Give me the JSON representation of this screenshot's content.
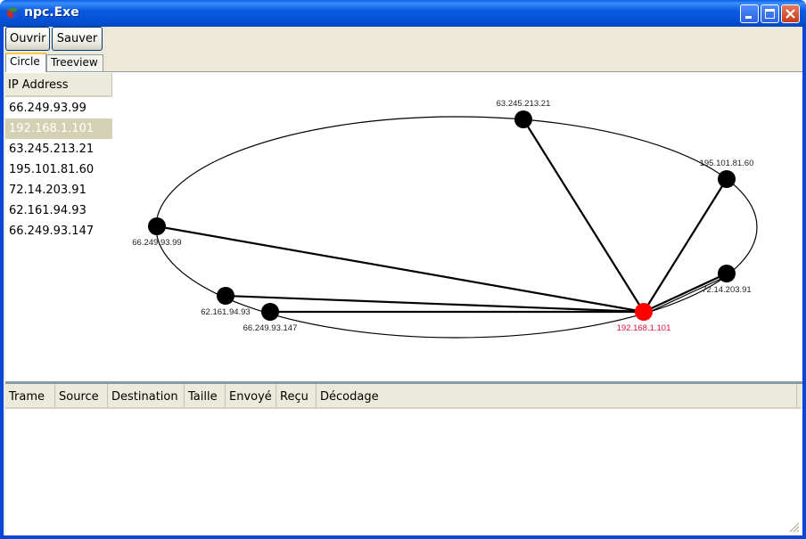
{
  "window": {
    "title": "npc.Exe",
    "controls": {
      "minimize": "minimize",
      "maximize": "maximize",
      "close": "close"
    }
  },
  "toolbar": {
    "open_label": "Ouvrir",
    "save_label": "Sauver"
  },
  "tabs": [
    {
      "label": "Circle",
      "active": true
    },
    {
      "label": "Treeview",
      "active": false
    }
  ],
  "ip_list": {
    "header": "IP Address",
    "items": [
      {
        "ip": "66.249.93.99",
        "selected": false
      },
      {
        "ip": "192.168.1.101",
        "selected": true
      },
      {
        "ip": "63.245.213.21",
        "selected": false
      },
      {
        "ip": "195.101.81.60",
        "selected": false
      },
      {
        "ip": "72.14.203.91",
        "selected": false
      },
      {
        "ip": "62.161.94.93",
        "selected": false
      },
      {
        "ip": "66.249.93.147",
        "selected": false
      }
    ]
  },
  "graph": {
    "layout": "circle",
    "center_node": "192.168.1.101",
    "colors": {
      "node": "#000000",
      "center_node": "#ff0000",
      "center_label": "#e0103a",
      "edge": "#000000"
    },
    "nodes": [
      {
        "id": "63.245.213.21",
        "label": "63.245.213.21"
      },
      {
        "id": "195.101.81.60",
        "label": "195.101.81.60"
      },
      {
        "id": "72.14.203.91",
        "label": "72.14.203.91"
      },
      {
        "id": "192.168.1.101",
        "label": "192.168.1.101"
      },
      {
        "id": "66.249.93.147",
        "label": "66.249.93.147"
      },
      {
        "id": "62.161.94.93",
        "label": "62.161.94.93"
      },
      {
        "id": "66.249.93.99",
        "label": "66.249.93.99"
      }
    ],
    "edges": [
      {
        "from": "192.168.1.101",
        "to": "63.245.213.21"
      },
      {
        "from": "192.168.1.101",
        "to": "195.101.81.60"
      },
      {
        "from": "192.168.1.101",
        "to": "72.14.203.91"
      },
      {
        "from": "192.168.1.101",
        "to": "72.14.203.91"
      },
      {
        "from": "192.168.1.101",
        "to": "66.249.93.99"
      },
      {
        "from": "192.168.1.101",
        "to": "62.161.94.93"
      },
      {
        "from": "192.168.1.101",
        "to": "66.249.93.147"
      }
    ]
  },
  "packet_table": {
    "columns": [
      "Trame",
      "Source",
      "Destination",
      "Taille",
      "Envoyé",
      "Reçu",
      "Décodage"
    ],
    "rows": []
  }
}
